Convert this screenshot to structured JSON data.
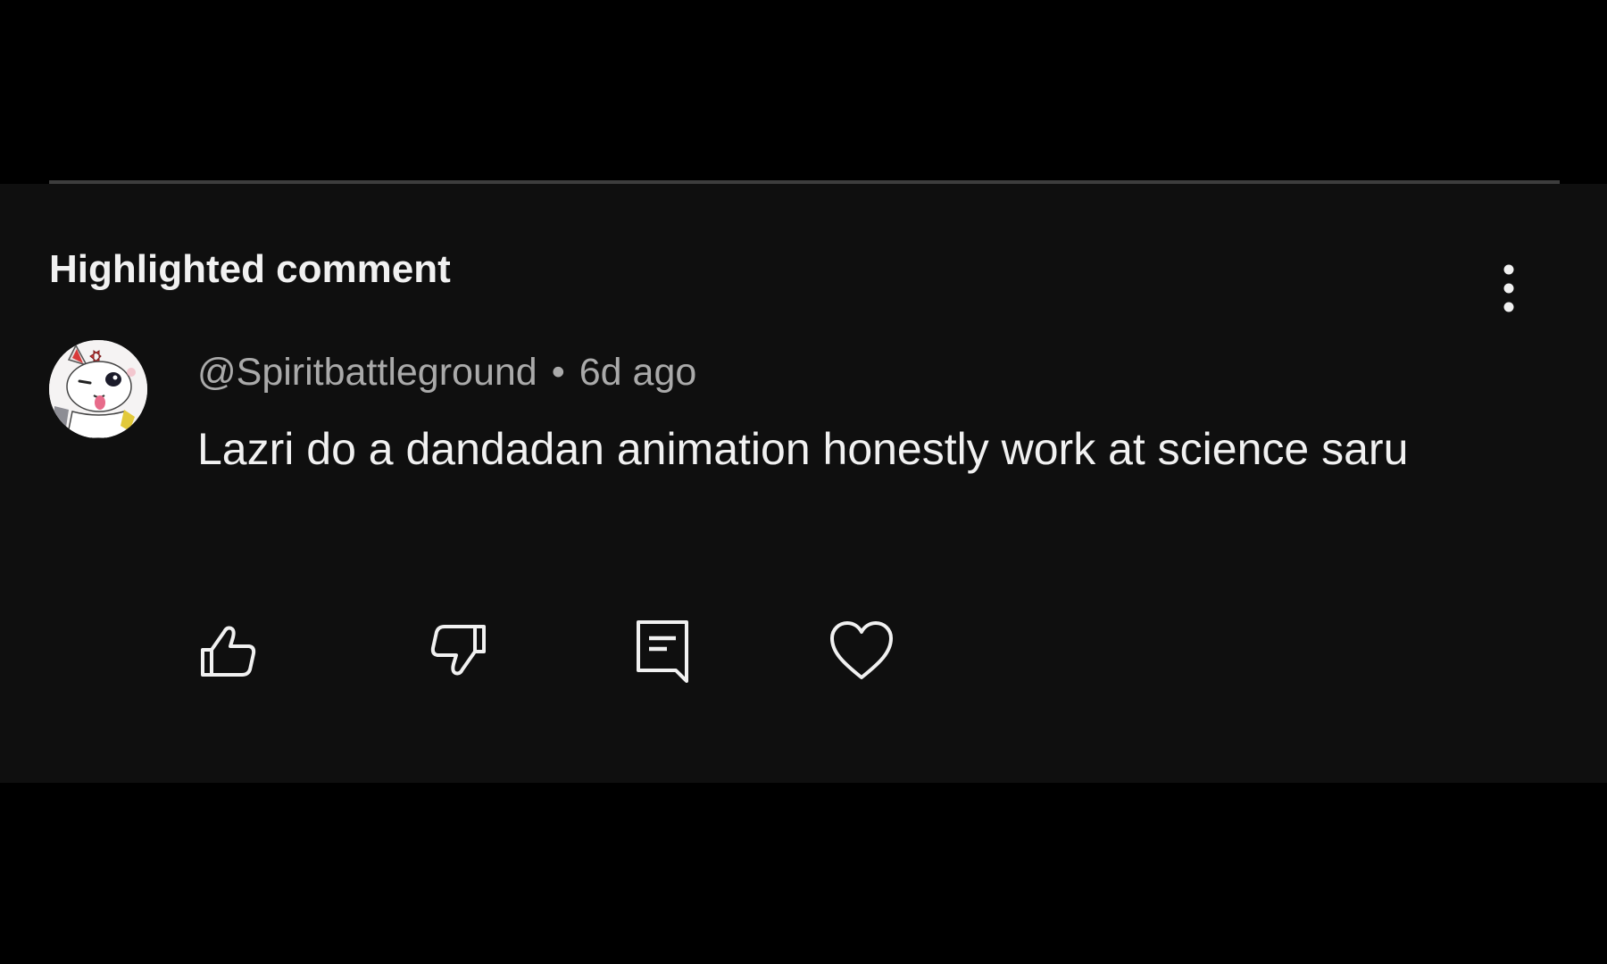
{
  "panel": {
    "title": "Highlighted comment",
    "more_icon": "vertical-ellipsis-icon"
  },
  "comment": {
    "avatar_icon": "cat-avatar",
    "author": "@Spiritbattleground",
    "separator": "•",
    "time": "6d ago",
    "text": "Lazri do a dandadan animation honestly work at science saru"
  },
  "actions": {
    "like_icon": "thumbs-up-icon",
    "dislike_icon": "thumbs-down-icon",
    "reply_icon": "reply-comment-icon",
    "heart_icon": "heart-icon"
  },
  "colors": {
    "page_background": "#000000",
    "panel_background": "#0f0f0f",
    "primary_text": "#f1f1f1",
    "secondary_text": "#aaaaaa"
  }
}
